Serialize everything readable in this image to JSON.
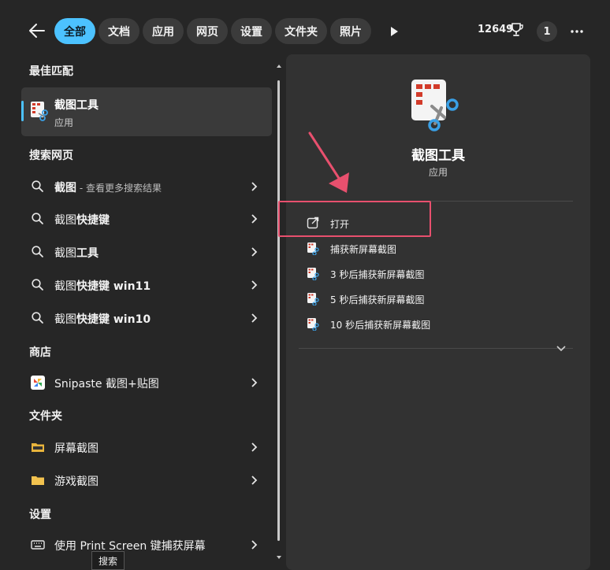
{
  "tabs": [
    {
      "label": "全部",
      "active": true
    },
    {
      "label": "文档"
    },
    {
      "label": "应用"
    },
    {
      "label": "网页"
    },
    {
      "label": "设置"
    },
    {
      "label": "文件夹"
    },
    {
      "label": "照片"
    }
  ],
  "topbar": {
    "points": "12649",
    "badge": "1"
  },
  "sections": {
    "best": "最佳匹配",
    "web": "搜索网页",
    "store": "商店",
    "folders": "文件夹",
    "settings": "设置"
  },
  "best_match": {
    "title": "截图工具",
    "subtitle": "应用"
  },
  "web_results": [
    {
      "bold": "截图",
      "rest": " - 查看更多搜索结果",
      "dim": true
    },
    {
      "bold": "截图",
      "rest": "快捷键"
    },
    {
      "bold": "截图",
      "rest": "工具"
    },
    {
      "bold": "截图",
      "rest": "快捷键 win11"
    },
    {
      "bold": "截图",
      "rest": "快捷键 win10"
    }
  ],
  "store_results": [
    {
      "label": "Snipaste 截图+贴图"
    }
  ],
  "folder_results": [
    {
      "label": "屏幕截图"
    },
    {
      "label": "游戏截图"
    }
  ],
  "settings_results": [
    {
      "label": "使用 Print Screen 键捕获屏幕"
    }
  ],
  "detail": {
    "title": "截图工具",
    "subtitle": "应用",
    "actions": [
      {
        "label": "打开",
        "icon": "open-external-icon"
      },
      {
        "label": "捕获新屏幕截图",
        "icon": "snipping-tool-icon"
      },
      {
        "label": "3 秒后捕获新屏幕截图",
        "icon": "snipping-tool-icon"
      },
      {
        "label": "5 秒后捕获新屏幕截图",
        "icon": "snipping-tool-icon"
      },
      {
        "label": "10 秒后捕获新屏幕截图",
        "icon": "snipping-tool-icon"
      }
    ]
  },
  "tooltip": "搜索",
  "colors": {
    "accent": "#4cc2ff",
    "highlight": "#e8506e"
  }
}
